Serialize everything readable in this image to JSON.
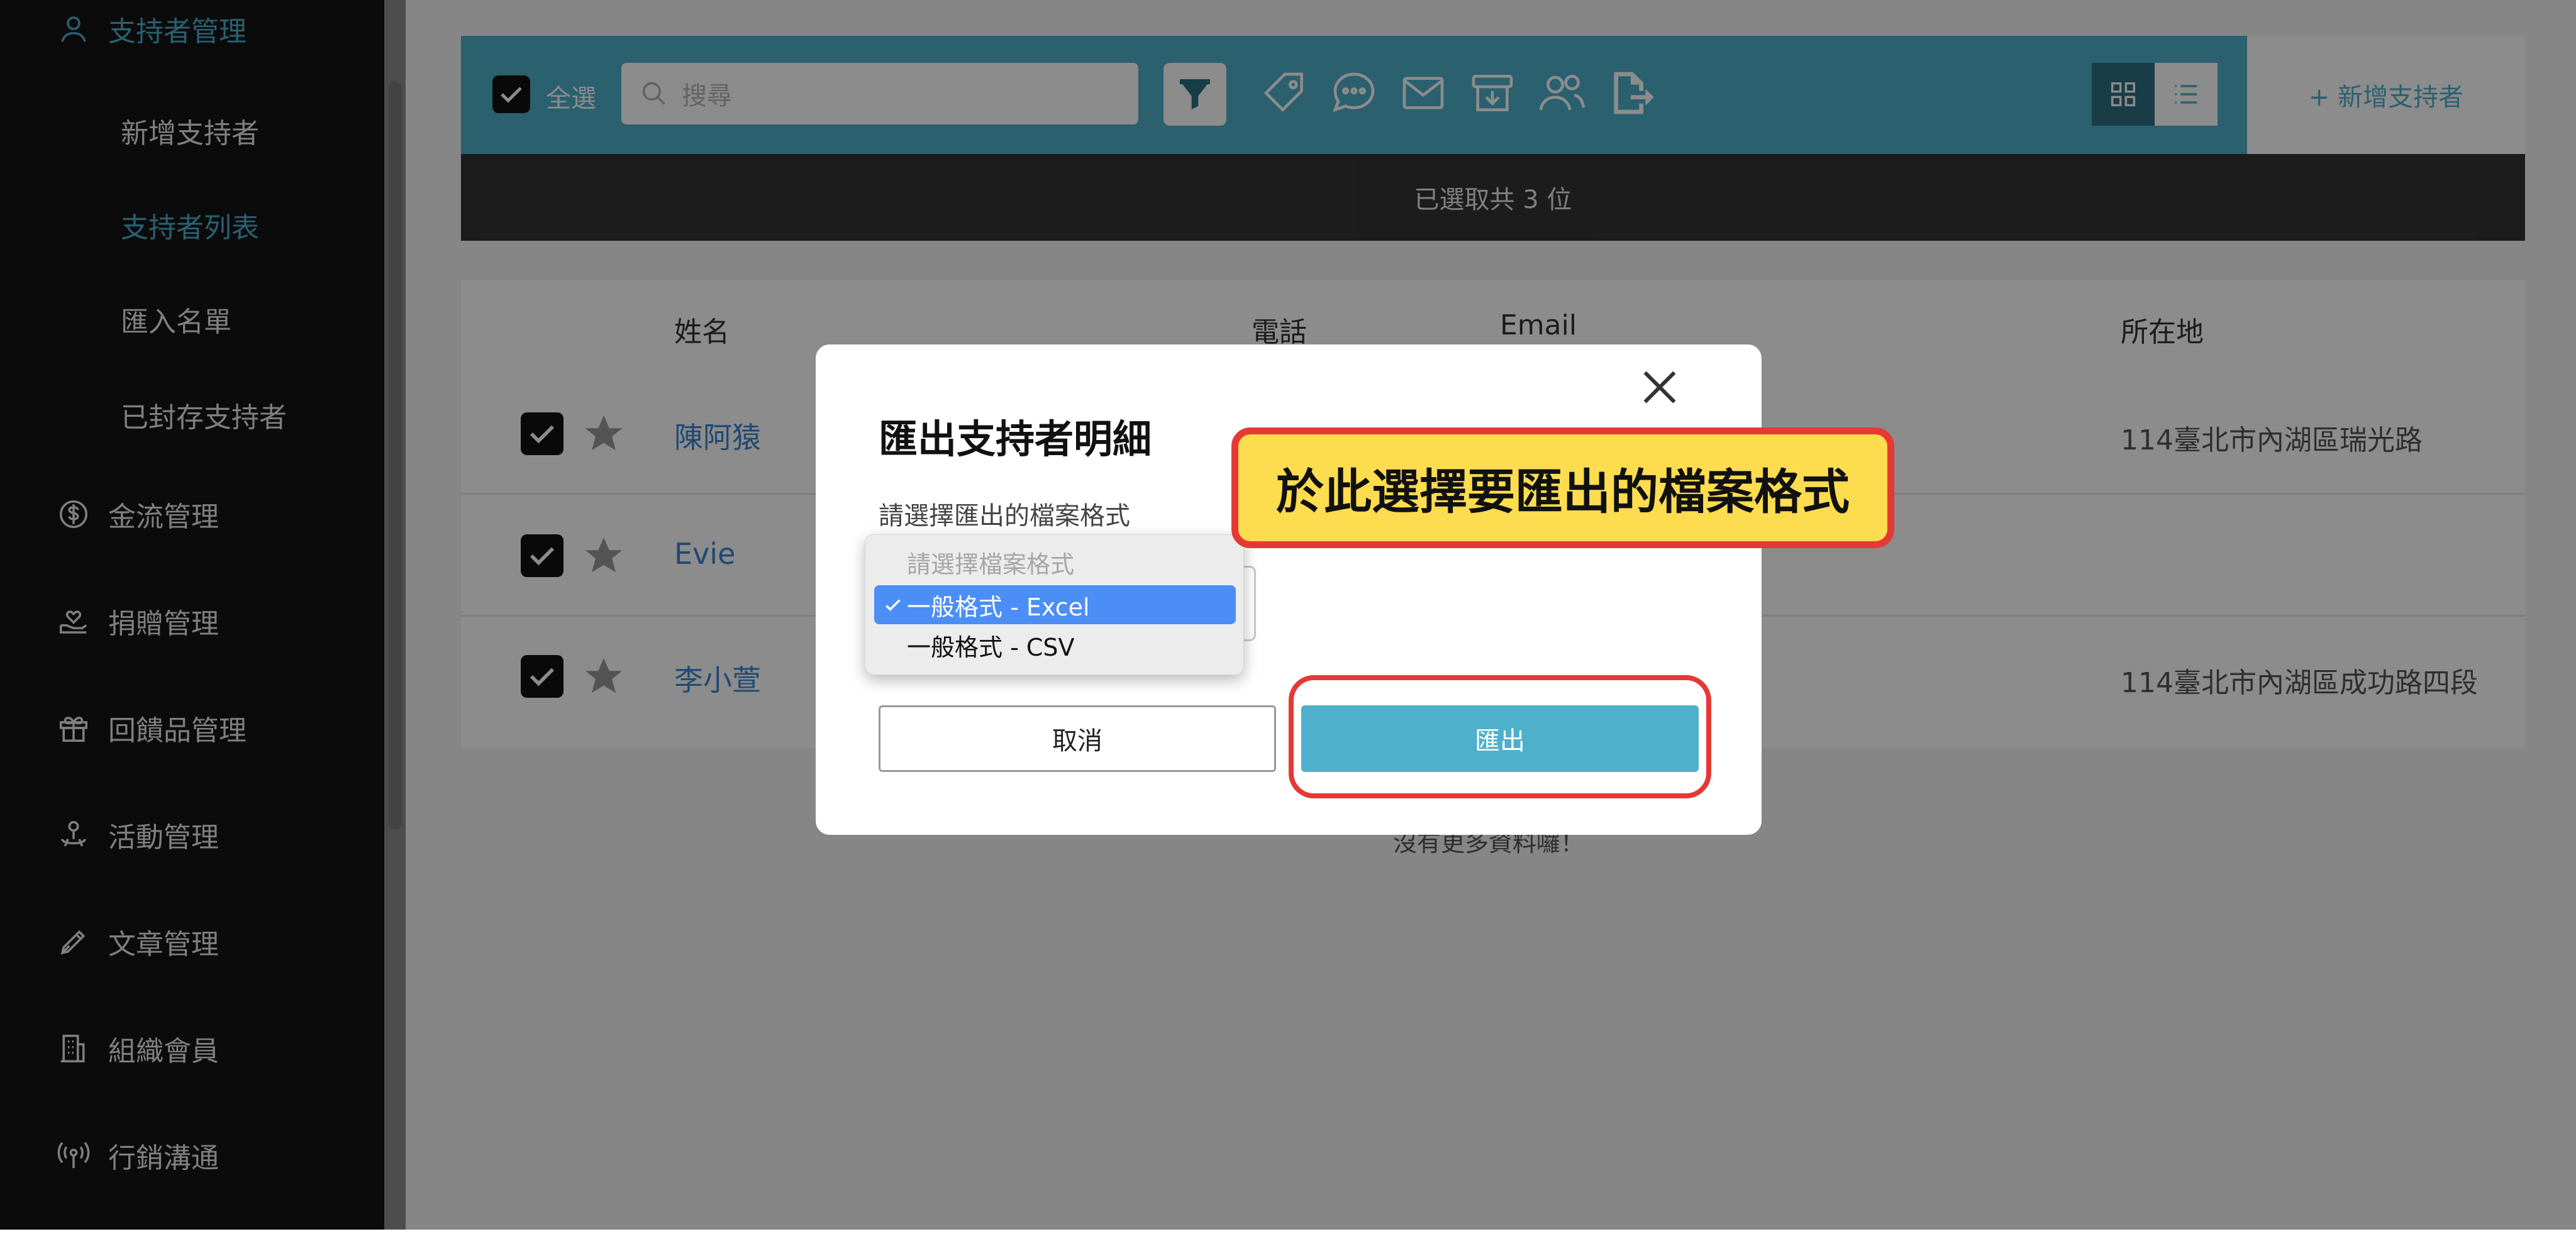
{
  "sidebar": {
    "section_title": "支持者管理",
    "sub_items": [
      {
        "label": "新增支持者",
        "active": false
      },
      {
        "label": "支持者列表",
        "active": true
      },
      {
        "label": "匯入名單",
        "active": false
      },
      {
        "label": "已封存支持者",
        "active": false
      }
    ],
    "items": [
      {
        "label": "金流管理",
        "icon": "dollar-icon"
      },
      {
        "label": "捐贈管理",
        "icon": "donate-icon"
      },
      {
        "label": "回饋品管理",
        "icon": "gift-icon"
      },
      {
        "label": "活動管理",
        "icon": "event-icon"
      },
      {
        "label": "文章管理",
        "icon": "pen-icon"
      },
      {
        "label": "組織會員",
        "icon": "building-icon"
      },
      {
        "label": "行銷溝通",
        "icon": "broadcast-icon"
      }
    ]
  },
  "toolbar": {
    "select_all_label": "全選",
    "search_placeholder": "搜尋",
    "add_supporter_label": "+ 新增支持者"
  },
  "selection_bar": {
    "text": "已選取共 3 位"
  },
  "table": {
    "columns": [
      "姓名",
      "電話",
      "Email",
      "所在地"
    ],
    "rows": [
      {
        "name": "陳阿猿",
        "location": "114臺北市內湖區瑞光路",
        "checked": true
      },
      {
        "name": "Evie",
        "location": "",
        "checked": true
      },
      {
        "name": "李小萱",
        "location": "114臺北市內湖區成功路四段",
        "checked": true
      }
    ],
    "footer": "沒有更多資料囉！"
  },
  "modal": {
    "title": "匯出支持者明細",
    "format_label": "請選擇匯出的檔案格式",
    "dropdown_options": [
      {
        "label": "請選擇檔案格式",
        "placeholder": true,
        "selected": false
      },
      {
        "label": "一般格式 - Excel",
        "placeholder": false,
        "selected": true
      },
      {
        "label": "一般格式 - CSV",
        "placeholder": false,
        "selected": false
      }
    ],
    "cancel_label": "取消",
    "export_label": "匯出"
  },
  "callout": {
    "text": "於此選擇要匯出的檔案格式"
  },
  "colors": {
    "accent": "#4fb0cb",
    "sidebar_bg": "#141414",
    "highlight_red": "#e53935",
    "callout_yellow": "#fedc4f",
    "dropdown_selected": "#4b8ef6"
  }
}
